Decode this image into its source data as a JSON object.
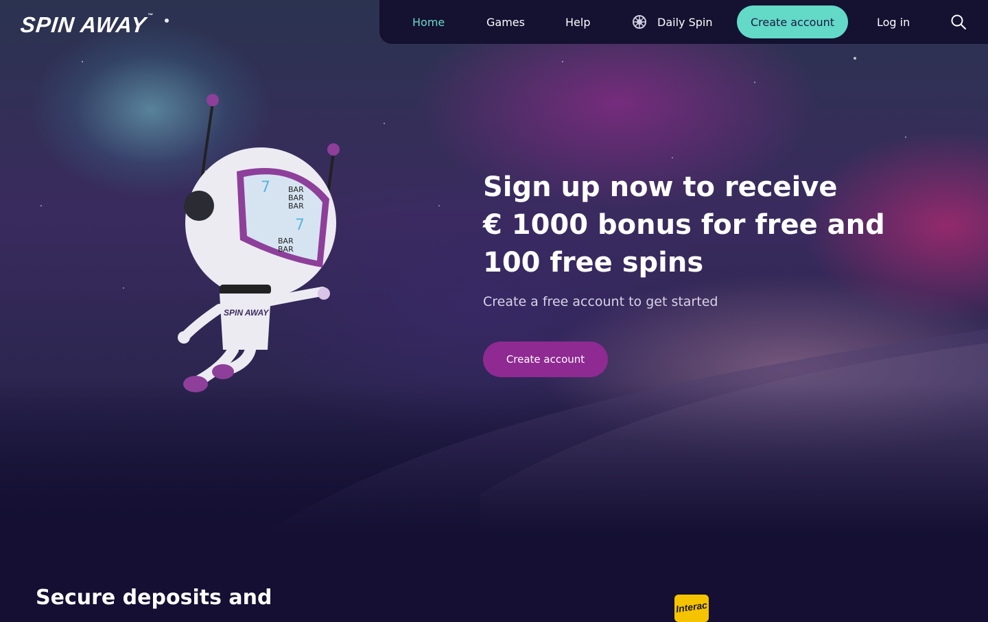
{
  "brand": {
    "logo_text": "SPIN AWAY",
    "tm": "™"
  },
  "nav": {
    "home": "Home",
    "games": "Games",
    "help": "Help",
    "daily_spin": "Daily Spin",
    "create_account": "Create account",
    "login": "Log in",
    "search_icon": "search-icon",
    "daily_spin_icon": "wheel-icon"
  },
  "hero": {
    "headline_line1": "Sign up now to receive",
    "headline_line2": "€ 1000 bonus for free and",
    "headline_line3": "100 free spins",
    "subtext": "Create a free account to get started",
    "cta": "Create account",
    "mascot_label": "SPIN AWAY",
    "reel_symbols": [
      "7",
      "BAR",
      "BAR",
      "BAR",
      "7",
      "BAR",
      "BAR"
    ]
  },
  "section": {
    "title": "Secure deposits and",
    "payment_logo_text": "Interac"
  },
  "colors": {
    "accent_teal": "#63d9c8",
    "cta_purple": "#8f2a92",
    "nav_bg": "#141131",
    "page_bg": "#140f33",
    "interac_yellow": "#f5c300"
  }
}
